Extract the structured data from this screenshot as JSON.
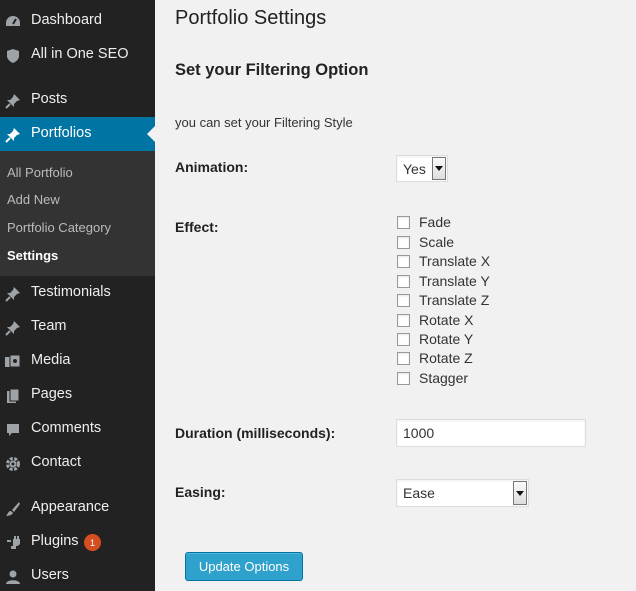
{
  "sidebar": {
    "items": [
      {
        "label": "Dashboard",
        "icon": "dashboard-icon"
      },
      {
        "label": "All in One SEO",
        "icon": "shield-icon"
      },
      {
        "label": "Posts",
        "icon": "pin-icon"
      },
      {
        "label": "Portfolios",
        "icon": "pin-icon"
      },
      {
        "label": "Testimonials",
        "icon": "pin-icon"
      },
      {
        "label": "Team",
        "icon": "pin-icon"
      },
      {
        "label": "Media",
        "icon": "media-icon"
      },
      {
        "label": "Pages",
        "icon": "pages-icon"
      },
      {
        "label": "Comments",
        "icon": "comment-icon"
      },
      {
        "label": "Contact",
        "icon": "gear-icon"
      },
      {
        "label": "Appearance",
        "icon": "brush-icon"
      },
      {
        "label": "Plugins",
        "icon": "plug-icon",
        "badge": "1"
      },
      {
        "label": "Users",
        "icon": "user-icon"
      }
    ],
    "submenu": [
      "All Portfolio",
      "Add New",
      "Portfolio Category",
      "Settings"
    ]
  },
  "main": {
    "title": "Portfolio Settings",
    "section_title": "Set your Filtering Option",
    "description": "you can set your Filtering Style",
    "animation": {
      "label": "Animation:",
      "value": "Yes"
    },
    "effect": {
      "label": "Effect:",
      "options": [
        "Fade",
        "Scale",
        "Translate X",
        "Translate Y",
        "Translate Z",
        "Rotate X",
        "Rotate Y",
        "Rotate Z",
        "Stagger"
      ]
    },
    "duration": {
      "label": "Duration (milliseconds):",
      "value": "1000"
    },
    "easing": {
      "label": "Easing:",
      "value": "Ease"
    },
    "update_label": "Update Options"
  },
  "colors": {
    "sidebar_bg": "#222222",
    "submenu_bg": "#333333",
    "active_bg": "#0074a2",
    "button_bg": "#2ea2cc",
    "badge_bg": "#d54e21"
  }
}
